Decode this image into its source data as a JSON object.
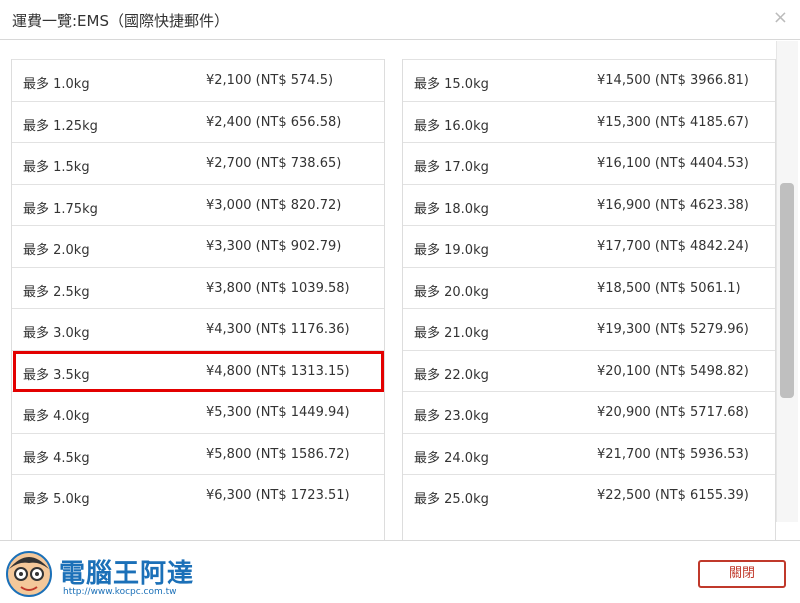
{
  "dialog": {
    "title": "運費一覽:EMS（國際快捷郵件）",
    "close_symbol": "×",
    "close_button_label": "關閉"
  },
  "left_rows": [
    {
      "weight": "最多 1.0kg",
      "price": "¥2,100 (NT$ 574.5)"
    },
    {
      "weight": "最多 1.25kg",
      "price": "¥2,400 (NT$ 656.58)"
    },
    {
      "weight": "最多 1.5kg",
      "price": "¥2,700 (NT$ 738.65)"
    },
    {
      "weight": "最多 1.75kg",
      "price": "¥3,000 (NT$ 820.72)"
    },
    {
      "weight": "最多 2.0kg",
      "price": "¥3,300 (NT$ 902.79)"
    },
    {
      "weight": "最多 2.5kg",
      "price": "¥3,800 (NT$ 1039.58)"
    },
    {
      "weight": "最多 3.0kg",
      "price": "¥4,300 (NT$ 1176.36)"
    },
    {
      "weight": "最多 3.5kg",
      "price": "¥4,800 (NT$ 1313.15)"
    },
    {
      "weight": "最多 4.0kg",
      "price": "¥5,300 (NT$ 1449.94)"
    },
    {
      "weight": "最多 4.5kg",
      "price": "¥5,800 (NT$ 1586.72)"
    },
    {
      "weight": "最多 5.0kg",
      "price": "¥6,300 (NT$ 1723.51)"
    }
  ],
  "right_rows": [
    {
      "weight": "最多 15.0kg",
      "price": "¥14,500 (NT$ 3966.81)"
    },
    {
      "weight": "最多 16.0kg",
      "price": "¥15,300 (NT$ 4185.67)"
    },
    {
      "weight": "最多 17.0kg",
      "price": "¥16,100 (NT$ 4404.53)"
    },
    {
      "weight": "最多 18.0kg",
      "price": "¥16,900 (NT$ 4623.38)"
    },
    {
      "weight": "最多 19.0kg",
      "price": "¥17,700 (NT$ 4842.24)"
    },
    {
      "weight": "最多 20.0kg",
      "price": "¥18,500 (NT$ 5061.1)"
    },
    {
      "weight": "最多 21.0kg",
      "price": "¥19,300 (NT$ 5279.96)"
    },
    {
      "weight": "最多 22.0kg",
      "price": "¥20,100 (NT$ 5498.82)"
    },
    {
      "weight": "最多 23.0kg",
      "price": "¥20,900 (NT$ 5717.68)"
    },
    {
      "weight": "最多 24.0kg",
      "price": "¥21,700 (NT$ 5936.53)"
    },
    {
      "weight": "最多 25.0kg",
      "price": "¥22,500 (NT$ 6155.39)"
    }
  ],
  "highlight": {
    "column": "left",
    "row_index": 6,
    "color": "#e30000"
  },
  "watermark": {
    "name": "電腦王阿達",
    "url": "http://www.kocpc.com.tw"
  },
  "colors": {
    "button_red": "#c0392b",
    "brand_blue": "#1b70b8"
  }
}
